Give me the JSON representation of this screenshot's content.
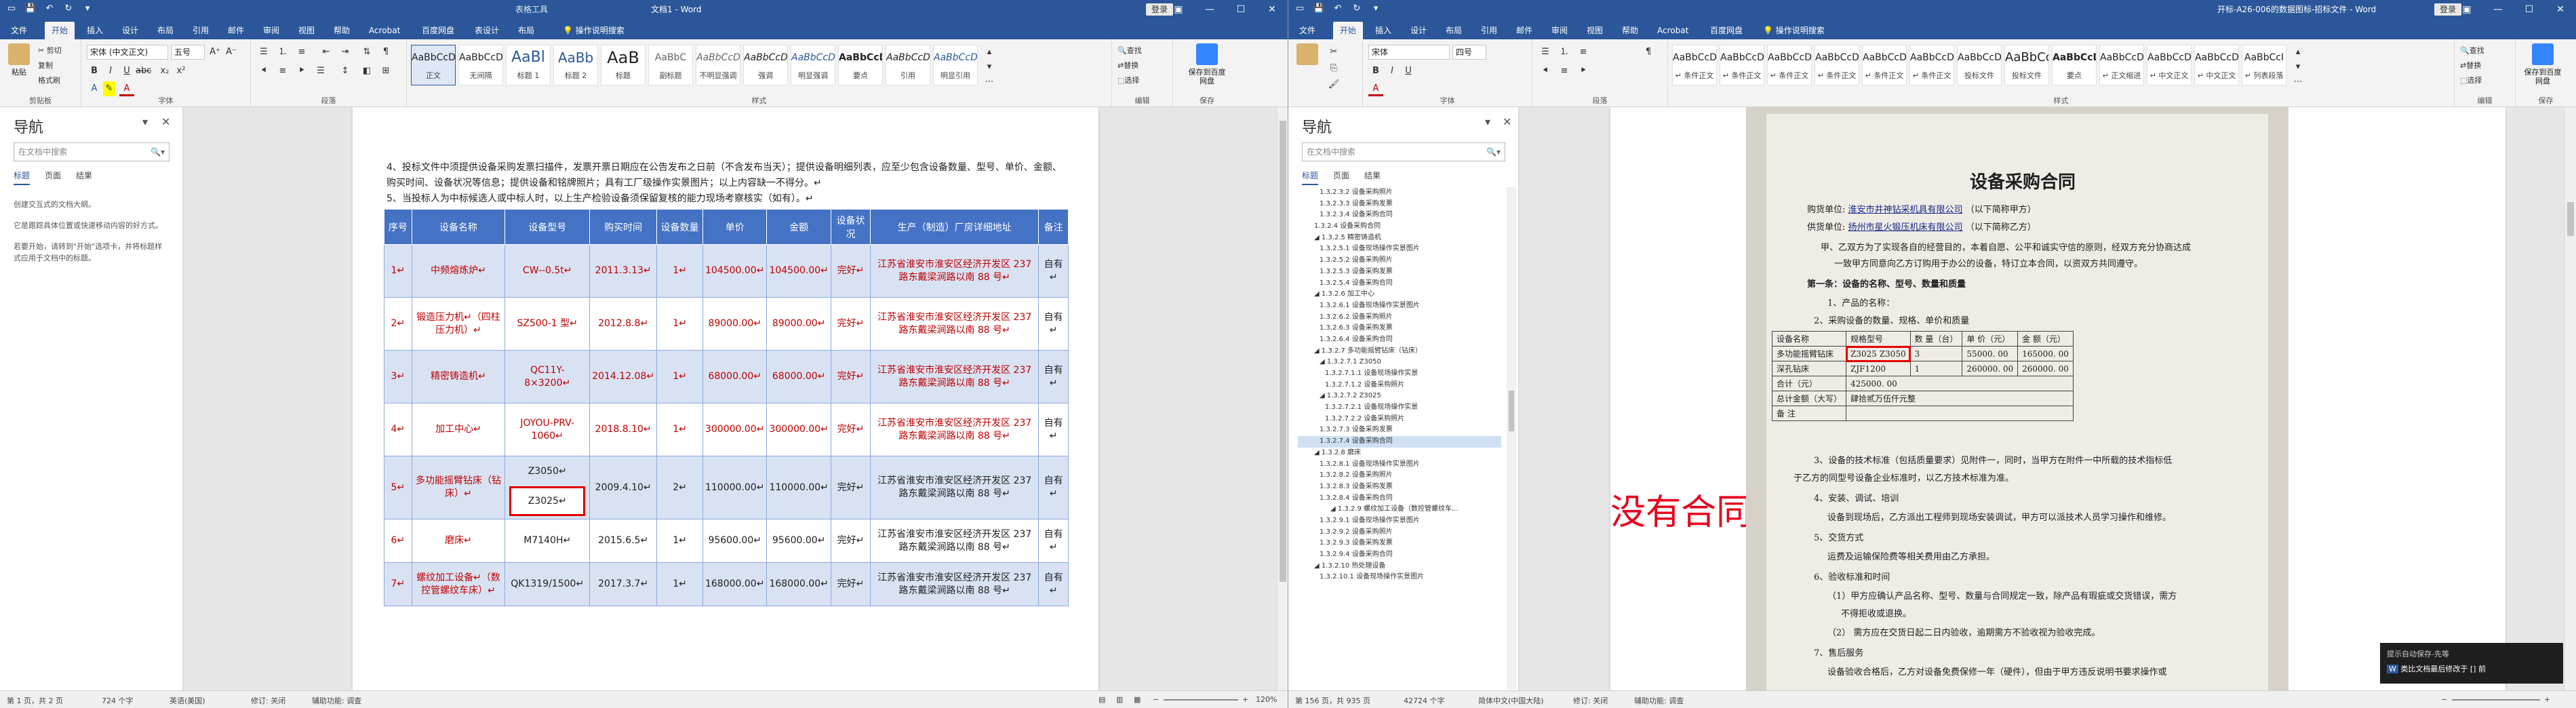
{
  "left": {
    "title": {
      "context_tab": "表格工具",
      "doc_title": "文档1 - Word",
      "login": "登录"
    },
    "tabs": [
      "文件",
      "开始",
      "插入",
      "设计",
      "布局",
      "引用",
      "邮件",
      "审阅",
      "视图",
      "帮助",
      "Acrobat",
      "百度网盘",
      "表设计",
      "布局"
    ],
    "tell_me": "操作说明搜索",
    "ribbon": {
      "paste": "粘贴",
      "cut": "✂ 剪切",
      "copy": "复制",
      "format_painter": "格式刷",
      "clipboard": "剪贴板",
      "font_name": "宋体 (中文正文)",
      "font_size": "五号",
      "font_group": "字体",
      "paragraph_group": "段落",
      "styles_group": "样式",
      "editing": [
        "查找",
        "替换",
        "选择"
      ],
      "editing_group": "编辑",
      "save_baidu": "保存到百度网盘",
      "save_group": "保存",
      "styles": [
        {
          "preview": "AaBbCcDd",
          "name": "正文"
        },
        {
          "preview": "AaBbCcDd",
          "name": "无间隔"
        },
        {
          "preview": "AaBl",
          "name": "标题 1"
        },
        {
          "preview": "AaBb",
          "name": "标题 2"
        },
        {
          "preview": "AaB",
          "name": "标题"
        },
        {
          "preview": "AaBbC",
          "name": "副标题"
        },
        {
          "preview": "AaBbCcDd",
          "name": "不明显强调"
        },
        {
          "preview": "AaBbCcDd",
          "name": "强调"
        },
        {
          "preview": "AaBbCcDd",
          "name": "明显强调"
        },
        {
          "preview": "AaBbCcDd",
          "name": "要点"
        },
        {
          "preview": "AaBbCcDd",
          "name": "引用"
        },
        {
          "preview": "AaBbCcDd",
          "name": "明显引用"
        }
      ]
    },
    "nav": {
      "title": "导航",
      "search_placeholder": "在文档中搜索",
      "tabs": [
        "标题",
        "页面",
        "结果"
      ],
      "hints": [
        "创建交互式的文档大纲。",
        "它是跟踪具体位置或快速移动内容的好方式。",
        "若要开始，请转到\"开始\"选项卡，并将标题样式应用于文档中的标题。"
      ]
    },
    "doc": {
      "paragraph4": "4、投标文件中须提供设备采购发票扫描件，发票开票日期应在公告发布之日前（不含发布当天）；提供设备明细列表，应至少包含设备数量、型号、单价、金额、购买时间、设备状况等信息；提供设备和铭牌照片；具有工厂级操作实景图片；以上内容缺一不得分。↵",
      "paragraph5": "5、当投标人为中标候选人或中标人时，以上生产检验设备须保留复核的能力现场考察核实（如有）。↵",
      "table": {
        "headers": [
          "序号",
          "设备名称",
          "设备型号",
          "购买时间",
          "设备数量",
          "单价",
          "金额",
          "设备状况",
          "生产（制造）厂房详细地址",
          "备注"
        ],
        "rows": [
          {
            "no": "1↵",
            "name": "中频熔炼炉↵",
            "model": "CW--0.5t↵",
            "date": "2011.3.13↵",
            "qty": "1↵",
            "price": "104500.00↵",
            "amount": "104500.00↵",
            "status": "完好↵",
            "address": "江苏省淮安市淮安区经济开发区 237 路东戴梁涧路以南 88 号↵",
            "remark": "自有↵"
          },
          {
            "no": "2↵",
            "name": "锻造压力机↵（四柱压力机）↵",
            "model": "SZ500-1 型↵",
            "date": "2012.8.8↵",
            "qty": "1↵",
            "price": "89000.00↵",
            "amount": "89000.00↵",
            "status": "完好↵",
            "address": "江苏省淮安市淮安区经济开发区 237 路东戴梁涧路以南 88 号↵",
            "remark": "自有↵"
          },
          {
            "no": "3↵",
            "name": "精密铸造机↵",
            "model": "QC11Y-8×3200↵",
            "date": "2014.12.08↵",
            "qty": "1↵",
            "price": "68000.00↵",
            "amount": "68000.00↵",
            "status": "完好↵",
            "address": "江苏省淮安市淮安区经济开发区 237 路东戴梁涧路以南 88 号↵",
            "remark": "自有↵"
          },
          {
            "no": "4↵",
            "name": "加工中心↵",
            "model": "JOYOU-PRV-1060↵",
            "date": "2018.8.10↵",
            "qty": "1↵",
            "price": "300000.00↵",
            "amount": "300000.00↵",
            "status": "完好↵",
            "address": "江苏省淮安市淮安区经济开发区 237 路东戴梁涧路以南 88 号↵",
            "remark": "自有↵"
          },
          {
            "no": "5↵",
            "name": "多功能摇臂钻床（钻床）↵",
            "model": "Z3050↵",
            "model2": "Z3025↵",
            "date": "2009.4.10↵",
            "qty": "2↵",
            "price": "110000.00↵",
            "amount": "110000.00↵",
            "status": "完好↵",
            "address": "江苏省淮安市淮安区经济开发区 237 路东戴梁涧路以南 88 号↵",
            "remark": "自有↵"
          },
          {
            "no": "6↵",
            "name": "磨床↵",
            "model": "M7140H↵",
            "date": "2015.6.5↵",
            "qty": "1↵",
            "price": "95600.00↵",
            "amount": "95600.00↵",
            "status": "完好↵",
            "address": "江苏省淮安市淮安区经济开发区 237 路东戴梁涧路以南 88 号↵",
            "remark": "自有↵"
          },
          {
            "no": "7↵",
            "name": "螺纹加工设备↵（数控管螺纹车床）↵",
            "model": "QK1319/1500↵",
            "date": "2017.3.7↵",
            "qty": "1↵",
            "price": "168000.00↵",
            "amount": "168000.00↵",
            "status": "完好↵",
            "address": "江苏省淮安市淮安区经济开发区 237 路东戴梁涧路以南 88 号↵",
            "remark": "自有↵"
          }
        ]
      }
    },
    "status": {
      "page": "第 1 页，共 2 页",
      "words": "724 个字",
      "lang": "英语(美国)",
      "track": "修订: 关闭",
      "access": "辅助功能: 调查",
      "zoom": "120%"
    }
  },
  "right": {
    "title": {
      "doc_title": "开标-A26-006的数据图标-招标文件 - Word",
      "login": "登录"
    },
    "tabs": [
      "文件",
      "开始",
      "插入",
      "设计",
      "布局",
      "引用",
      "邮件",
      "审阅",
      "视图",
      "帮助",
      "Acrobat",
      "百度网盘"
    ],
    "tell_me": "操作说明搜索",
    "ribbon": {
      "font_name": "宋体",
      "font_size": "四号",
      "styles": [
        {
          "preview": "AaBbCcDc",
          "name": "↵ 条件正文"
        },
        {
          "preview": "AaBbCcDc",
          "name": "↵ 条件正文"
        },
        {
          "preview": "AaBbCcDc",
          "name": "↵ 条件正文"
        },
        {
          "preview": "AaBbCcDc",
          "name": "↵ 条件正文"
        },
        {
          "preview": "AaBbCcDc",
          "name": "↵ 条件正文"
        },
        {
          "preview": "AaBbCcDc",
          "name": "↵ 条件正文"
        },
        {
          "preview": "AaBbCcDc",
          "name": "投标文件"
        },
        {
          "preview": "AaBbCc",
          "name": "投标文件"
        },
        {
          "preview": "AaBbCcDc",
          "name": "要点"
        },
        {
          "preview": "AaBbCcDc",
          "name": "↵ 正文缩进"
        },
        {
          "preview": "AaBbCcDc",
          "name": "↵ 中文正文"
        },
        {
          "preview": "AaBbCcDc",
          "name": "↵ 中文正文"
        },
        {
          "preview": "AaBbCcI",
          "name": "↵ 列表段落"
        }
      ],
      "editing": [
        "查找",
        "替换",
        "选择"
      ],
      "save_baidu": "保存到百度网盘",
      "font_group": "字体",
      "paragraph_group": "段落",
      "styles_group": "样式",
      "editing_group": "编辑",
      "save_group": "保存"
    },
    "nav": {
      "title": "导航",
      "search_placeholder": "在文档中搜索",
      "tabs": [
        "标题",
        "页面",
        "结果"
      ],
      "tree": [
        "1.3.2.3.2 设备采购照片",
        "1.3.2.3.3 设备采购发票",
        "1.3.2.3.4 设备采购合同",
        "1.3.2.4 设备采购合同",
        "◢ 1.3.2.5 精密铸造机",
        "1.3.2.5.1 设备现场操作实景图片",
        "1.3.2.5.2 设备采购照片",
        "1.3.2.5.3 设备采购发票",
        "1.3.2.5.4 设备采购合同",
        "◢ 1.3.2.6 加工中心",
        "1.3.2.6.1 设备现场操作实景图片",
        "1.3.2.6.2 设备采购照片",
        "1.3.2.6.3 设备采购发票",
        "1.3.2.6.4 设备采购合同",
        "◢ 1.3.2.7 多功能摇臂钻床（钻床）",
        "◢ 1.3.2.7.1 Z3050",
        "1.3.2.7.1.1 设备现场操作实景",
        "1.3.2.7.1.2 设备采购照片",
        "◢ 1.3.2.7.2 Z3025",
        "1.3.2.7.2.1 设备现场操作实景",
        "1.3.2.7.2.2 设备采购照片",
        "1.3.2.7.3 设备采购发票",
        "1.3.2.7.4 设备采购合同",
        "◢ 1.3.2.8 磨床",
        "1.3.2.8.1 设备现场操作实景图片",
        "1.3.2.8.2 设备采购照片",
        "1.3.2.8.3 设备采购发票",
        "1.3.2.8.4 设备采购合同",
        "◢ 1.3.2.9 螺纹加工设备（数控管螺纹车...",
        "1.3.2.9.1 设备现场操作实景图片",
        "1.3.2.9.2 设备采购照片",
        "1.3.2.9.3 设备采购发票",
        "1.3.2.9.4 设备采购合同",
        "◢ 1.3.2.10 热处理设备",
        "1.3.2.10.1 设备现场操作实景图片"
      ],
      "selected_index": 22
    },
    "contract": {
      "title": "设备采购合同",
      "buyer_label": "购货单位:",
      "buyer": "淮安市井神钻采机具有限公司",
      "buyer_suffix": "（以下简称甲方）",
      "seller_label": "供货单位:",
      "seller": "扬州市星火锻压机床有限公司",
      "seller_suffix": "（以下简称乙方）",
      "intro1": "甲、乙双方为了实现各自的经营目的，本着自愿、公平和诚实守信的原则，经双方充分协商达成",
      "intro2": "一致甲方同意向乙方订购用于办公的设备，特订立本合同，以资双方共同遵守。",
      "clause1": "第一条：设备的名称、型号、数量和质量",
      "item1": "1、产品的名称：",
      "item2": "2、采购设备的数量、规格、单价和质量",
      "table_headers": [
        "设备名称",
        "规格型号",
        "数 量（台）",
        "单 价（元）",
        "金 额（元）"
      ],
      "table_rows": [
        [
          "多功能摇臂钻床",
          "Z3025  Z3050",
          "3",
          "55000. 00",
          "165000. 00"
        ],
        [
          "深孔钻床",
          "ZJF1200",
          "1",
          "260000. 00",
          "260000. 00"
        ]
      ],
      "total_label": "合计（元）",
      "total_value": "425000. 00",
      "total_cn_label": "总计金额（大写）",
      "total_cn_value": "肆拾贰万伍仟元整",
      "note_label": "备    注",
      "p3": "3、设备的技术标准（包括质量要求）见附件一，同时，当甲方在附件一中所载的技术指标低",
      "p3b": "于乙方的同型号设备企业标准时，以乙方技术标准为准。",
      "p4": "4、安装、调试、培训",
      "p4b": "设备到现场后，乙方派出工程师到现场安装调试，甲方可以派技术人员学习操作和维修。",
      "p5": "5、交货方式",
      "p5b": "运费及运输保险费等相关费用由乙方承担。",
      "p6": "6、验收标准和时间",
      "p6b": "（1）甲方应确认产品名称、型号、数量与合同规定一致，除产品有瑕疵或交货错误，需方",
      "p6c": "不得拒收或退换。",
      "p6d": "（2）  需方应在交货日起二日内验收，逾期需方不验收视为验收完成。",
      "p7": "7、售后服务",
      "p7b": "设备验收合格后，乙方对设备免费保修一年（硬件），但由于甲方违反说明书要求操作或"
    },
    "annotation": "没有合同",
    "toast": {
      "line1": "提示自动保存-先等",
      "line2": "类比文档最后修改于 [] 前"
    },
    "status": {
      "page": "第 156 页，共 935 页",
      "words": "42724 个字",
      "lang": "简体中文(中国大陆)",
      "track": "修订: 关闭",
      "access": "辅助功能: 调查"
    }
  }
}
